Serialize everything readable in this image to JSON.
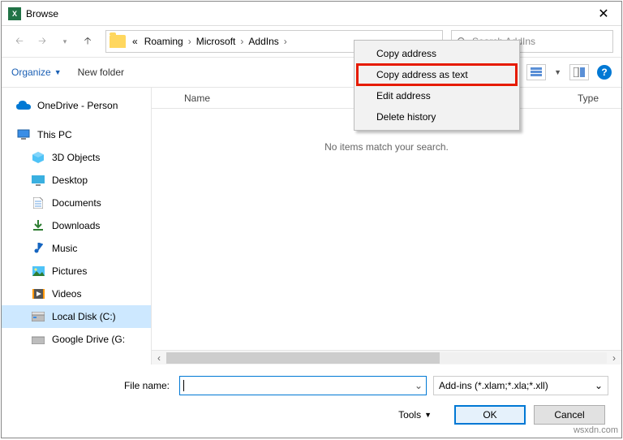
{
  "title": "Browse",
  "breadcrumb": {
    "pre": "«",
    "items": [
      "Roaming",
      "Microsoft",
      "AddIns"
    ]
  },
  "search": {
    "placeholder": "Search AddIns"
  },
  "toolbar": {
    "organize": "Organize",
    "newfolder": "New folder"
  },
  "columns": {
    "name": "Name",
    "type": "Type"
  },
  "empty_msg": "No items match your search.",
  "context": {
    "copy_address": "Copy address",
    "copy_text": "Copy address as text",
    "edit": "Edit address",
    "delete": "Delete history"
  },
  "sidebar": {
    "onedrive": "OneDrive - Person",
    "thispc": "This PC",
    "items": [
      "3D Objects",
      "Desktop",
      "Documents",
      "Downloads",
      "Music",
      "Pictures",
      "Videos",
      "Local Disk (C:)",
      "Google Drive (G:"
    ]
  },
  "footer": {
    "filename_label": "File name:",
    "filter": "Add-ins (*.xlam;*.xla;*.xll)",
    "tools": "Tools",
    "ok": "OK",
    "cancel": "Cancel"
  },
  "watermark": "wsxdn.com"
}
